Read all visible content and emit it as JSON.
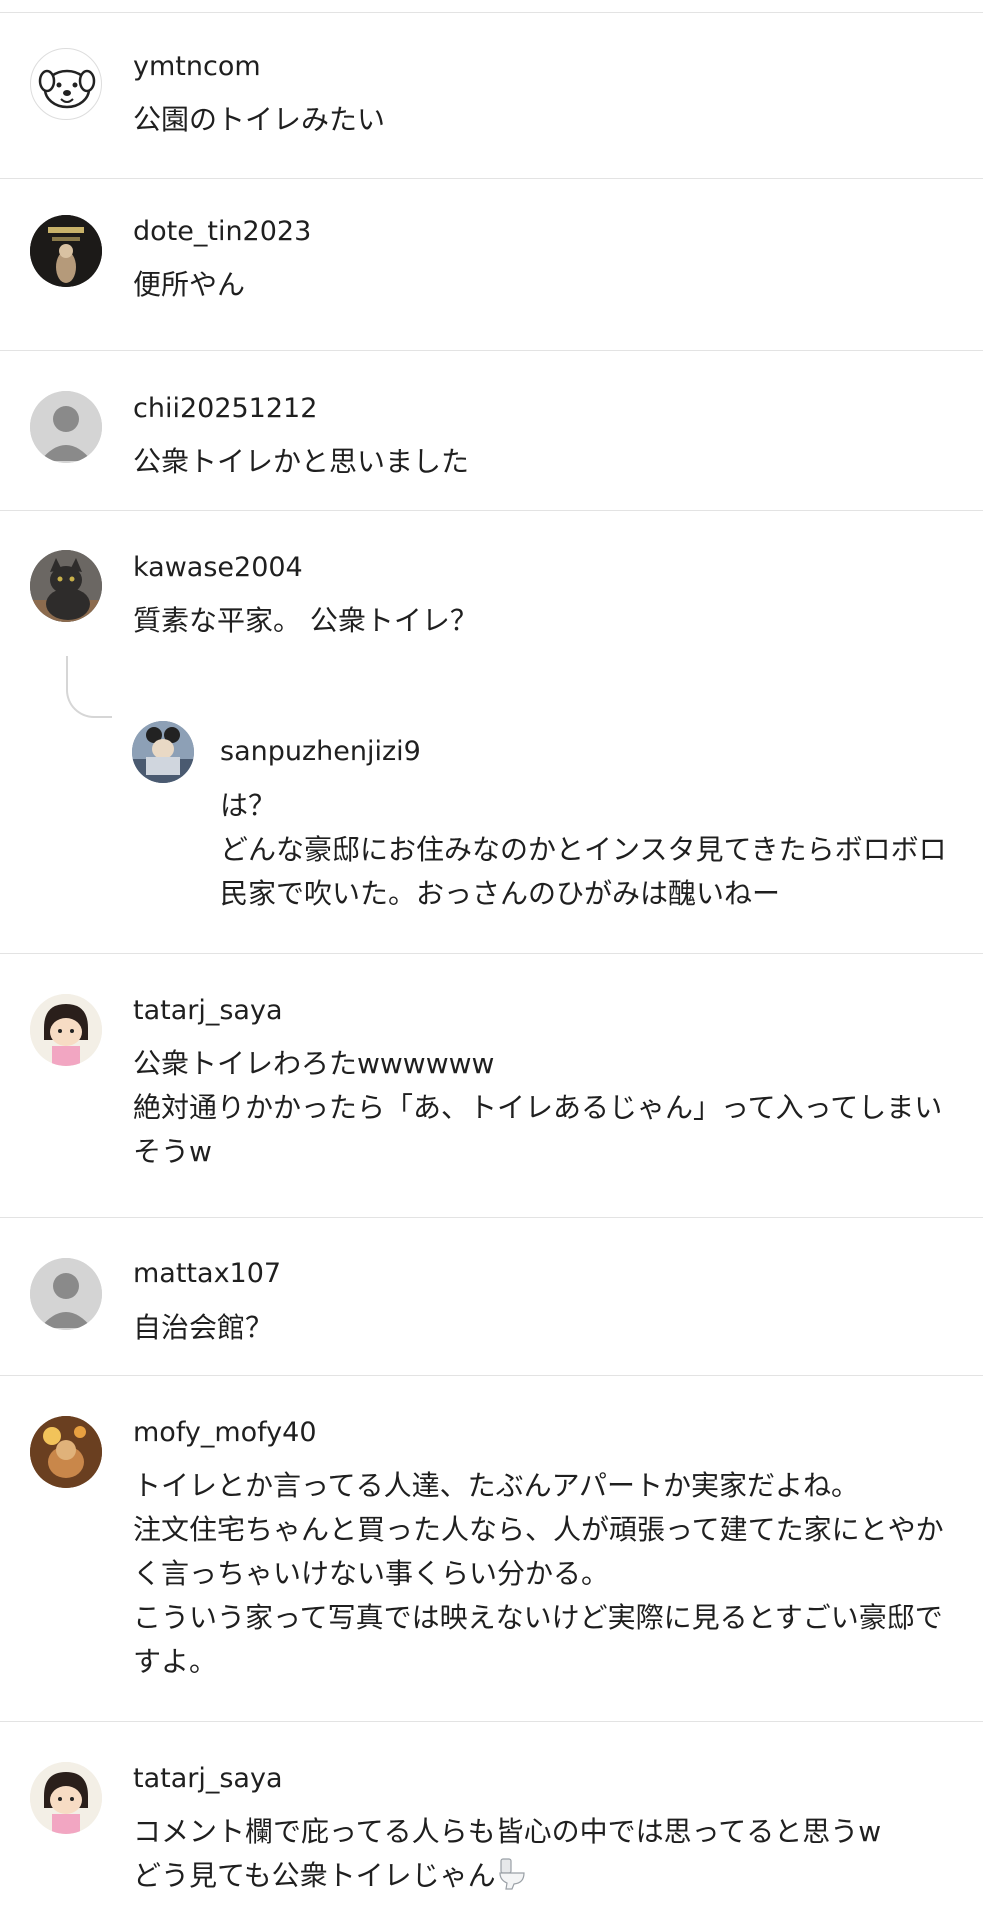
{
  "comments": [
    {
      "username": "ymtncom",
      "text": "公園のトイレみたい",
      "avatar": "dog-cartoon-avatar"
    },
    {
      "username": "dote_tin2023",
      "text": "便所やん",
      "avatar": "dark-photo-avatar"
    },
    {
      "username": "chii20251212",
      "text": "公衆トイレかと思いました",
      "avatar": "default-person-avatar"
    },
    {
      "username": "kawase2004",
      "text": "質素な平家。 公衆トイレ？",
      "avatar": "cat-photo-avatar",
      "reply": {
        "username": "sanpuzhenjizi9",
        "text": "は？\nどんな豪邸にお住みなのかとインスタ見てきたらボロボロ民家で吹いた。おっさんのひがみは醜いねー",
        "avatar": "character-photo-avatar"
      }
    },
    {
      "username": "tatarj_saya",
      "text": "公衆トイレわろたwwwwww\n絶対通りかかったら「あ、トイレあるじゃん」って入ってしまいそうw",
      "avatar": "anime-girl-avatar"
    },
    {
      "username": "mattax107",
      "text": "自治会館？",
      "avatar": "default-person-avatar"
    },
    {
      "username": "mofy_mofy40",
      "text": "トイレとか言ってる人達、たぶんアパートか実家だよね。\n注文住宅ちゃんと買った人なら、人が頑張って建てた家にとやかく言っちゃいけない事くらい分かる。\nこういう家って写真では映えないけど実際に見るとすごい豪邸ですよ。",
      "avatar": "warm-photo-avatar"
    },
    {
      "username": "tatarj_saya",
      "text": "コメント欄で庇ってる人らも皆心の中では思ってると思うw\nどう見ても公衆トイレじゃん",
      "avatar": "anime-girl-avatar",
      "trailing_icon": "toilet-icon"
    }
  ],
  "colors": {
    "divider": "#e3e3e3",
    "text": "#1f1f1f",
    "default_avatar_bg": "#d4d4d4",
    "default_avatar_fg": "#8a8a8a"
  }
}
